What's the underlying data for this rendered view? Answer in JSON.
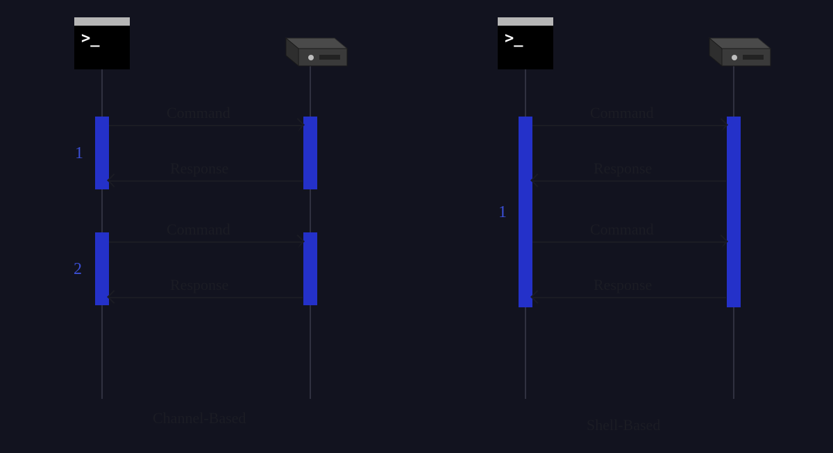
{
  "diagrams": {
    "left": {
      "caption": "Channel-Based",
      "messages": {
        "m1": "Command",
        "m2": "Response",
        "m3": "Command",
        "m4": "Response"
      },
      "sequence_numbers": {
        "n1": "1",
        "n2": "2"
      }
    },
    "right": {
      "caption": "Shell-Based",
      "messages": {
        "m1": "Command",
        "m2": "Response",
        "m3": "Command",
        "m4": "Response"
      },
      "sequence_numbers": {
        "n1": "1"
      }
    }
  },
  "icons": {
    "terminal_prompt": ">_",
    "terminal_name": "terminal-icon",
    "server_name": "server-icon"
  },
  "colors": {
    "background": "#12131f",
    "activation": "#2431c9",
    "line": "#303140",
    "text": "#1b1c24",
    "seq_number": "#3b4fd6"
  }
}
